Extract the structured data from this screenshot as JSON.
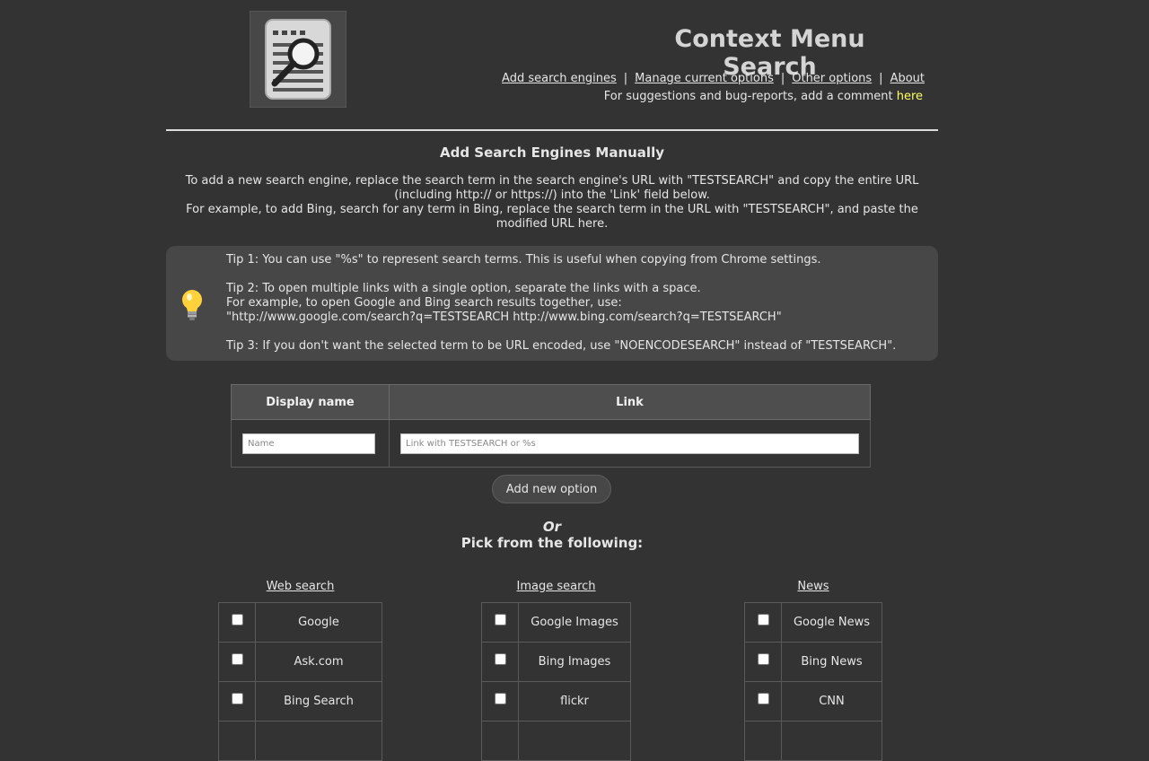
{
  "app": {
    "title": "Context Menu Search",
    "logo_icon": "document-search-icon"
  },
  "nav": {
    "links": [
      "Add search engines",
      "Manage current options",
      "Other options",
      "About"
    ],
    "separator": "|"
  },
  "feedback": {
    "text": "For suggestions and bug-reports, add a comment ",
    "link": "here",
    "link_color": "#ffff66"
  },
  "manual": {
    "title": "Add Search Engines Manually",
    "line1": "To add a new search engine, replace the search term in the search engine's URL with \"TESTSEARCH\" and copy the entire URL (including http:// or https://) into the 'Link' field below.",
    "line2": "For example, to add Bing, search for any term in Bing, replace the search term in the URL with \"TESTSEARCH\", and paste the modified URL here."
  },
  "tips": {
    "icon": "lightbulb-icon",
    "tip1": "Tip 1: You can use \"%s\" to represent search terms. This is useful when copying from Chrome settings.",
    "tip2_line1": "Tip 2: To open multiple links with a single option, separate the links with a space.",
    "tip2_line2": "For example, to open Google and Bing search results together, use:",
    "tip2_line3": "\"http://www.google.com/search?q=TESTSEARCH http://www.bing.com/search?q=TESTSEARCH\"",
    "tip3": "Tip 3: If you don't want the selected term to be URL encoded, use \"NOENCODESEARCH\" instead of \"TESTSEARCH\"."
  },
  "form": {
    "col_display_name": "Display name",
    "col_link": "Link",
    "name_placeholder": "Name",
    "link_placeholder": "Link with TESTSEARCH or %s",
    "add_button": "Add new option"
  },
  "picker": {
    "or": "Or",
    "title": "Pick from the following:"
  },
  "categories": {
    "web": {
      "title": "Web search",
      "items": [
        "Google",
        "Ask.com",
        "Bing Search"
      ]
    },
    "image": {
      "title": "Image search",
      "items": [
        "Google Images",
        "Bing Images",
        "flickr"
      ]
    },
    "news": {
      "title": "News",
      "items": [
        "Google News",
        "Bing News",
        "CNN"
      ]
    }
  }
}
